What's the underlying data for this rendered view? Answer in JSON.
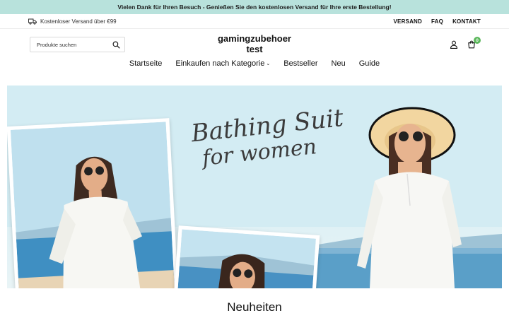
{
  "announcement": "Vielen Dank für Ihren Besuch - Genießen Sie den kostenlosen Versand für Ihre erste Bestellung!",
  "topbar": {
    "shipping_text": "Kostenloser Versand über €99",
    "links": [
      "VERSAND",
      "FAQ",
      "KONTAKT"
    ]
  },
  "header": {
    "search_placeholder": "Produkte suchen",
    "logo_line1": "gamingzubehoer",
    "logo_line2": "test",
    "cart_count": "0"
  },
  "nav": {
    "items": [
      "Startseite",
      "Einkaufen nach Kategorie",
      "Bestseller",
      "Neu",
      "Guide"
    ]
  },
  "hero": {
    "title_line1": "Bathing Suit",
    "title_line2": "for women"
  },
  "section": {
    "title": "Neuheiten"
  },
  "colors": {
    "announce_bg": "#b8e2dc",
    "badge": "#5cb85c"
  }
}
